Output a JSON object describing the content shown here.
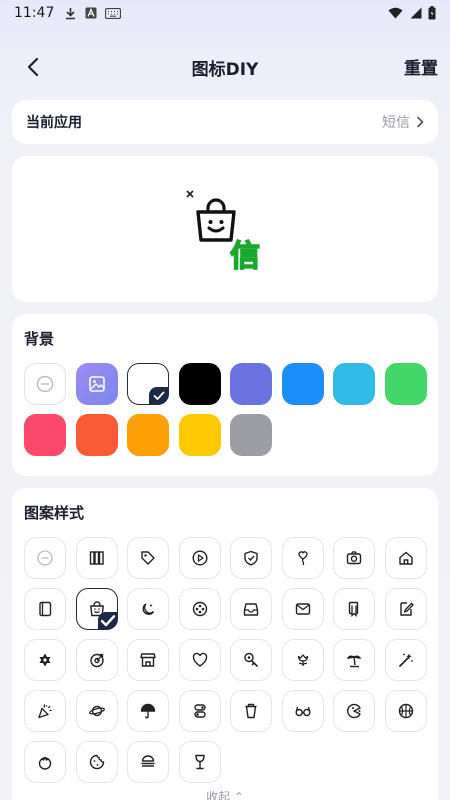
{
  "status_bar": {
    "time": "11:47"
  },
  "header": {
    "title": "图标DIY",
    "reset_label": "重置"
  },
  "current_app": {
    "label": "当前应用",
    "value": "短信"
  },
  "preview": {
    "badge_text": "信",
    "badge_color": "#22c93a"
  },
  "background": {
    "title": "背景",
    "swatches": [
      {
        "type": "none"
      },
      {
        "type": "image"
      },
      {
        "type": "color",
        "color": "#ffffff",
        "selected": true
      },
      {
        "type": "color",
        "color": "#000000"
      },
      {
        "type": "color",
        "color": "#6b72e0"
      },
      {
        "type": "color",
        "color": "#1a8ffb"
      },
      {
        "type": "color",
        "color": "#2fbbe8"
      },
      {
        "type": "color",
        "color": "#45d668"
      },
      {
        "type": "color",
        "color": "#fb4a69"
      },
      {
        "type": "color",
        "color": "#fb5a36"
      },
      {
        "type": "color",
        "color": "#fd9f07"
      },
      {
        "type": "color",
        "color": "#fec802"
      },
      {
        "type": "color",
        "color": "#9d9ea4"
      }
    ]
  },
  "patterns": {
    "title": "图案样式",
    "collapse_label": "收起 ⌃",
    "icons": [
      "none-icon",
      "books-icon",
      "tag-icon",
      "play-icon",
      "shield-icon",
      "balloon-icon",
      "camera-icon",
      "home-icon",
      "book-icon",
      "shopping-bag-icon",
      "moon-icon",
      "film-reel-icon",
      "inbox-icon",
      "mail-icon",
      "bookmark-icon",
      "edit-icon",
      "star-of-david-icon",
      "target-icon",
      "store-icon",
      "heart-icon",
      "wrench-icon",
      "flower-icon",
      "palm-tree-icon",
      "magic-wand-icon",
      "party-popper-icon",
      "planet-icon",
      "umbrella-icon",
      "toggle-icon",
      "cup-icon",
      "glasses-icon",
      "pacman-icon",
      "basketball-icon",
      "tomato-icon",
      "cookie-icon",
      "burger-icon",
      "wine-glass-icon"
    ],
    "selected_index": 9
  }
}
